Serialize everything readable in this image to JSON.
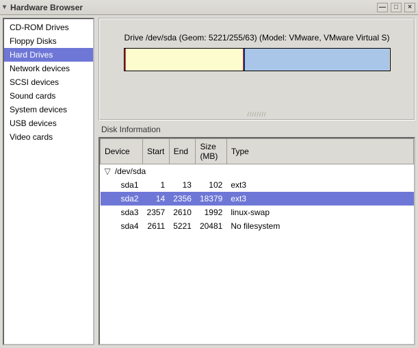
{
  "window": {
    "title": "Hardware Browser"
  },
  "sidebar": {
    "items": [
      {
        "label": "CD-ROM Drives",
        "selected": false
      },
      {
        "label": "Floppy Disks",
        "selected": false
      },
      {
        "label": "Hard Drives",
        "selected": true
      },
      {
        "label": "Network devices",
        "selected": false
      },
      {
        "label": "SCSI devices",
        "selected": false
      },
      {
        "label": "Sound cards",
        "selected": false
      },
      {
        "label": "System devices",
        "selected": false
      },
      {
        "label": "USB devices",
        "selected": false
      },
      {
        "label": "Video cards",
        "selected": false
      }
    ]
  },
  "drive": {
    "label": "Drive /dev/sda (Geom: 5221/255/63) (Model: VMware, VMware Virtual S)",
    "segments": [
      {
        "color": "#fdfccf",
        "width_pct": 0.5
      },
      {
        "color": "#fdfccf",
        "width_pct": 44.5
      },
      {
        "color": "#a9c6e8",
        "width_pct": 5.0
      },
      {
        "color": "#a9c6e8",
        "width_pct": 50.0
      }
    ]
  },
  "disk_info": {
    "heading": "Disk Information",
    "columns": [
      "Device",
      "Start",
      "End",
      "Size (MB)",
      "Type"
    ],
    "parent": {
      "name": "/dev/sda"
    },
    "rows": [
      {
        "device": "sda1",
        "start": 1,
        "end": 13,
        "size_mb": 102,
        "type": "ext3",
        "selected": false
      },
      {
        "device": "sda2",
        "start": 14,
        "end": 2356,
        "size_mb": 18379,
        "type": "ext3",
        "selected": true
      },
      {
        "device": "sda3",
        "start": 2357,
        "end": 2610,
        "size_mb": 1992,
        "type": "linux-swap",
        "selected": false
      },
      {
        "device": "sda4",
        "start": 2611,
        "end": 5221,
        "size_mb": 20481,
        "type": "No filesystem",
        "selected": false
      }
    ]
  }
}
